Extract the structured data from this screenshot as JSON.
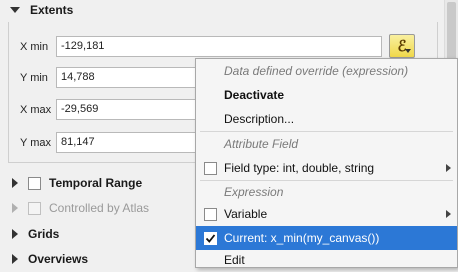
{
  "extents": {
    "title": "Extents",
    "fields": [
      {
        "label": "X min",
        "value": "-129,181"
      },
      {
        "label": "Y min",
        "value": "14,788"
      },
      {
        "label": "X max",
        "value": "-29,569"
      },
      {
        "label": "Y max",
        "value": "81,147"
      }
    ]
  },
  "sections": {
    "temporal_range": "Temporal Range",
    "controlled_by_atlas": "Controlled by Atlas",
    "grids": "Grids",
    "overviews": "Overviews"
  },
  "menu": {
    "header_dd": "Data defined override (expression)",
    "deactivate": "Deactivate",
    "description": "Description...",
    "header_attr": "Attribute Field",
    "field_type": "Field type: int, double, string",
    "header_expr": "Expression",
    "variable": "Variable",
    "current": "Current: x_min(my_canvas())",
    "edit": "Edit"
  },
  "colors": {
    "selected_bg": "#2c78d6",
    "dd_button_yellow": "#f0d84a"
  }
}
